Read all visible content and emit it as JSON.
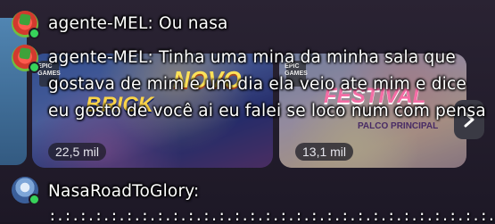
{
  "tiles": [
    {
      "badge": "EPIC GAMES",
      "title_top": "NOVO",
      "title_main": "BRICK",
      "views": "22,5 mil"
    },
    {
      "badge": "EPIC GAMES",
      "title_main": "FESTIVAL",
      "subtitle": "PALCO PRINCIPAL",
      "views": "13,1 mil"
    }
  ],
  "next_icon": "chevron-right-icon",
  "chat": {
    "messages": [
      {
        "user": "agente-MEL:",
        "text": "Ou nasa",
        "avatar": "green-character-avatar",
        "status_color": "#37d35a"
      },
      {
        "user": "agente-MEL:",
        "text": "Tinha uma mina da minha sala que gostava de mim e um dia ela veio ate mim e dice eu gosto de você ai eu falei se loco num com pensa",
        "avatar": "green-character-avatar",
        "status_color": "#37d35a"
      },
      {
        "user": "NasaRoadToGlory:",
        "text": "",
        "avatar": "astronaut-avatar",
        "status_color": "#37d35a"
      }
    ],
    "cutoff_line": ":.:.:.:.:.:.:.:.:.:.:.:.:.:.:.:.:.:.:.:.:.:.:.:.:.:.:.:.:."
  }
}
